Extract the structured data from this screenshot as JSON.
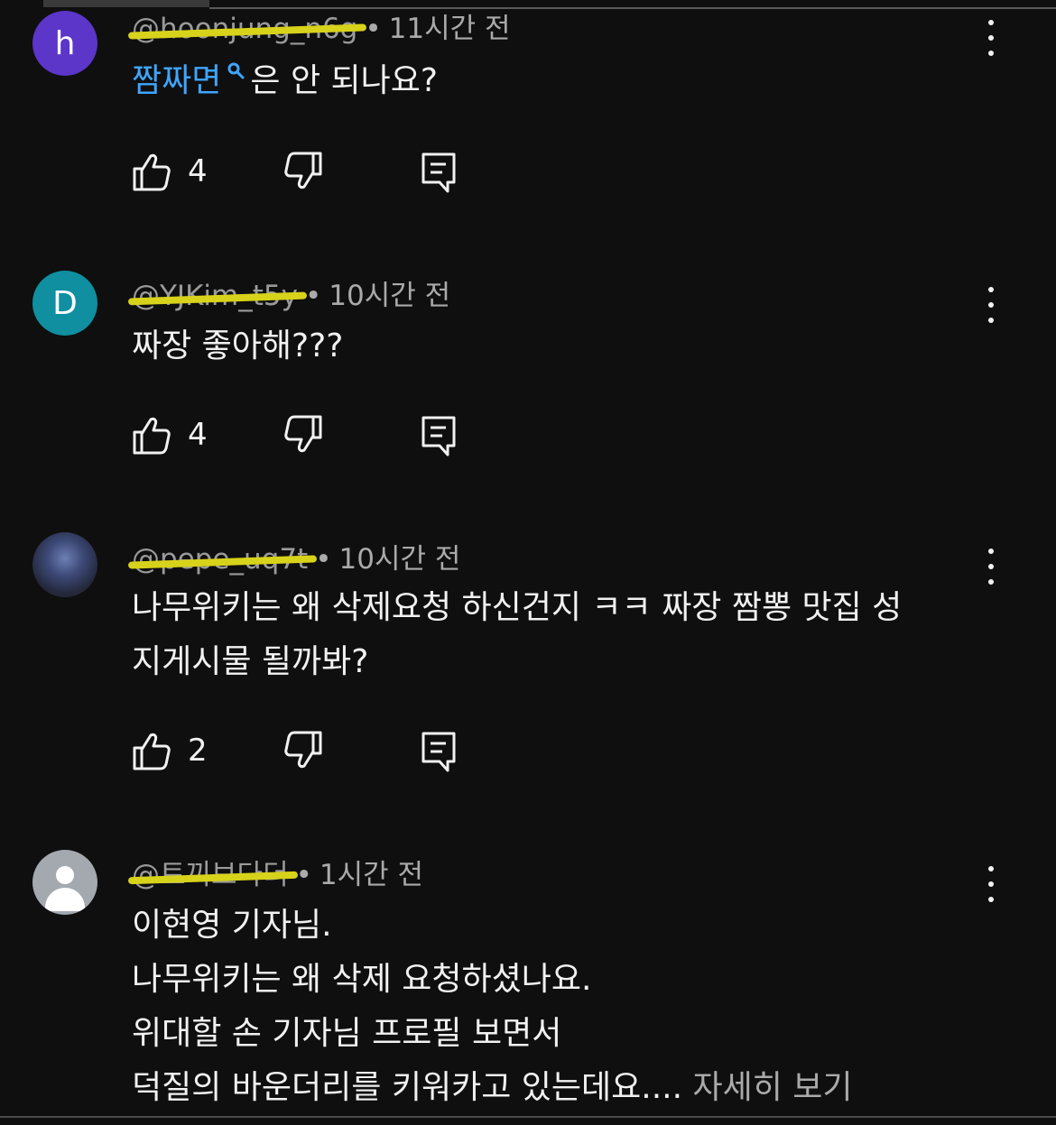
{
  "comments": [
    {
      "avatar_letter": "h",
      "avatar_color": "#5c35c9",
      "handle": "@hoonjung_n6g",
      "time": "11시간 전",
      "link_text": "짬짜면",
      "text": "은 안 되나요?",
      "likes": "4"
    },
    {
      "avatar_letter": "D",
      "avatar_color": "#0f8fa0",
      "handle": "@YJKim_t5y",
      "time": "10시간 전",
      "text": "짜장 좋아해???",
      "likes": "4"
    },
    {
      "handle": "@pepe_uq7t",
      "time": "10시간 전",
      "lines": [
        "나무위키는 왜 삭제요청 하신건지 ㅋㅋ 짜장 짬뽕 맛집 성",
        "지게시물 될까봐?"
      ],
      "likes": "2"
    },
    {
      "handle": "@토끼보다더",
      "time": "1시간 전",
      "lines": [
        "이현영 기자님.",
        "나무위키는 왜 삭제 요청하셨나요.",
        "위대할 손 기자님 프로필 보면서",
        "덕질의 바운더리를 키워카고 있는데요...."
      ],
      "more_label": "자세히 보기"
    }
  ],
  "separator": "•"
}
